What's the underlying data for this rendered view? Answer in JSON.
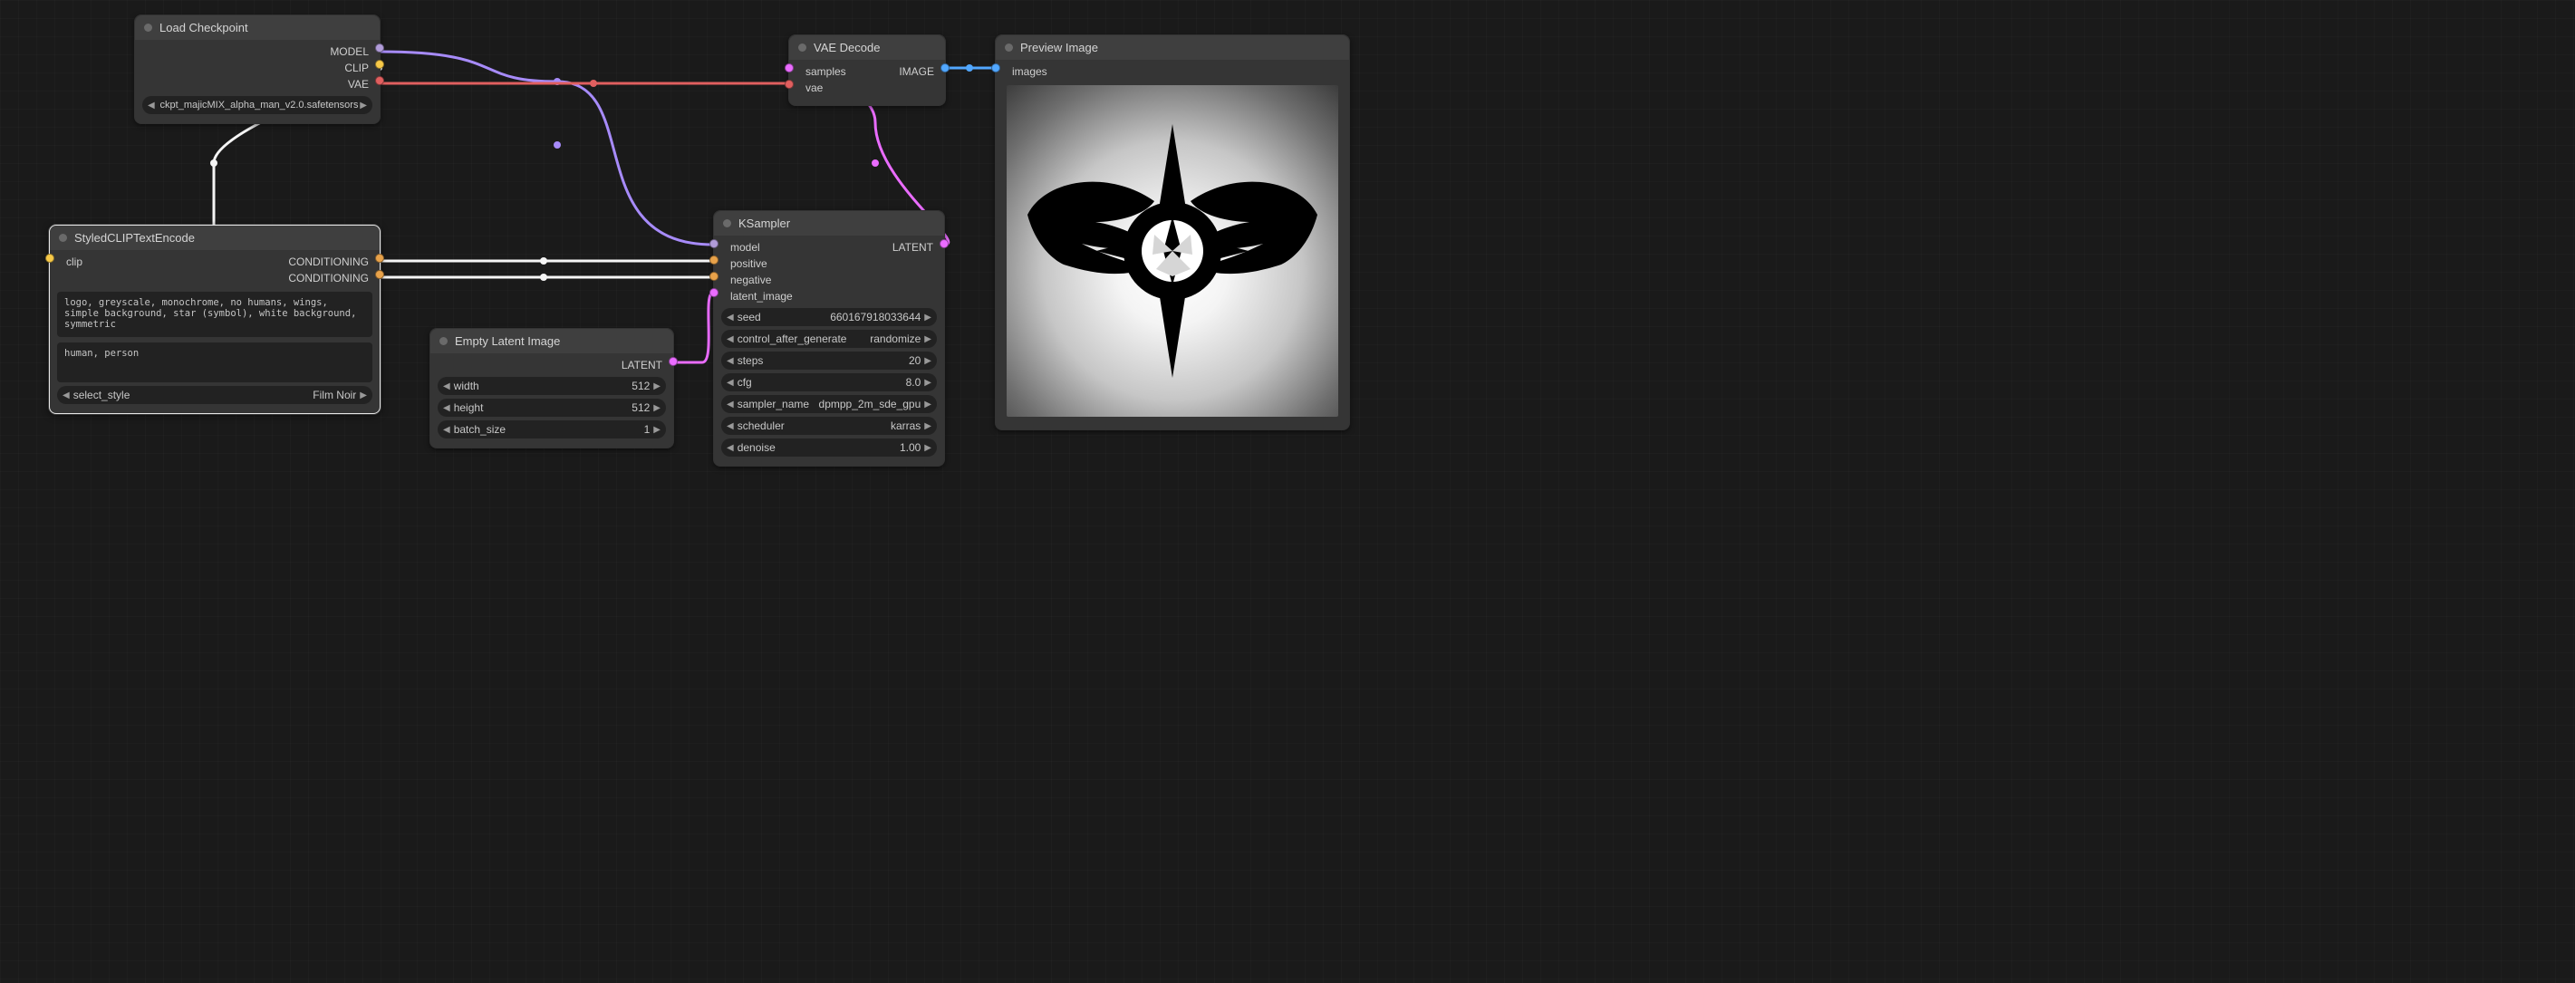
{
  "nodes": {
    "load_checkpoint": {
      "title": "Load Checkpoint",
      "outputs": {
        "model": "MODEL",
        "clip": "CLIP",
        "vae": "VAE"
      },
      "ckpt_label": "ckpt_majicMIX_alpha_man_v2.0.safetensors"
    },
    "styled_clip": {
      "title": "StyledCLIPTextEncode",
      "inputs": {
        "clip": "clip"
      },
      "outputs": {
        "cond1": "CONDITIONING",
        "cond2": "CONDITIONING"
      },
      "positive_text": "logo, greyscale, monochrome, no humans, wings, simple background, star (symbol), white background, symmetric",
      "negative_text": "human, person",
      "select_style_label": "select_style",
      "select_style_value": "Film Noir"
    },
    "empty_latent": {
      "title": "Empty Latent Image",
      "outputs": {
        "latent": "LATENT"
      },
      "width_label": "width",
      "width_value": "512",
      "height_label": "height",
      "height_value": "512",
      "batch_label": "batch_size",
      "batch_value": "1"
    },
    "ksampler": {
      "title": "KSampler",
      "inputs": {
        "model": "model",
        "positive": "positive",
        "negative": "negative",
        "latent_image": "latent_image"
      },
      "outputs": {
        "latent": "LATENT"
      },
      "seed_label": "seed",
      "seed_value": "660167918033644",
      "control_label": "control_after_generate",
      "control_value": "randomize",
      "steps_label": "steps",
      "steps_value": "20",
      "cfg_label": "cfg",
      "cfg_value": "8.0",
      "sampler_label": "sampler_name",
      "sampler_value": "dpmpp_2m_sde_gpu",
      "scheduler_label": "scheduler",
      "scheduler_value": "karras",
      "denoise_label": "denoise",
      "denoise_value": "1.00"
    },
    "vae_decode": {
      "title": "VAE Decode",
      "inputs": {
        "samples": "samples",
        "vae": "vae"
      },
      "outputs": {
        "image": "IMAGE"
      }
    },
    "preview": {
      "title": "Preview Image",
      "inputs": {
        "images": "images"
      }
    }
  },
  "links": [
    {
      "from": "load_checkpoint.model",
      "to": "ksampler.model",
      "color": "#a78bfa"
    },
    {
      "from": "load_checkpoint.clip",
      "to": "styled_clip.clip",
      "color": "#f5f5f5"
    },
    {
      "from": "load_checkpoint.vae",
      "to": "vae_decode.vae",
      "color": "#e05f5f"
    },
    {
      "from": "styled_clip.cond1",
      "to": "ksampler.positive",
      "color": "#f5f5f5"
    },
    {
      "from": "styled_clip.cond2",
      "to": "ksampler.negative",
      "color": "#f5f5f5"
    },
    {
      "from": "empty_latent.latent",
      "to": "ksampler.latent_image",
      "color": "#ea6cff"
    },
    {
      "from": "ksampler.latent",
      "to": "vae_decode.samples",
      "color": "#ea6cff"
    },
    {
      "from": "vae_decode.image",
      "to": "preview.images",
      "color": "#51a7ff"
    }
  ]
}
